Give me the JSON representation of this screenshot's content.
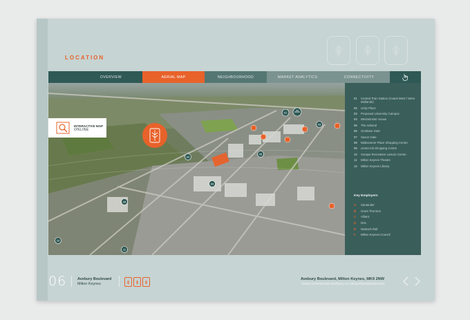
{
  "section_title": "LOCATION",
  "nav": {
    "tabs": [
      {
        "label": "OVERVIEW"
      },
      {
        "label": "AERIAL MAP"
      },
      {
        "label": "NEIGHBOURHOOD"
      },
      {
        "label": "MARKET ANALYTICS"
      },
      {
        "label": "CONNECTIVITY"
      }
    ],
    "active_tab": "AERIAL MAP"
  },
  "map": {
    "interactive_label_line1": "INTERACTIVE MAP",
    "interactive_label_line2": "ONLINE"
  },
  "legend": {
    "places": [
      {
        "num": "01",
        "label": "Central Train Station (Avanti West / West Midlands)"
      },
      {
        "num": "02",
        "label": "Unity Place"
      },
      {
        "num": "03",
        "label": "Proposed University Campus"
      },
      {
        "num": "04",
        "label": "Westminster House"
      },
      {
        "num": "05",
        "label": "The Admiral"
      },
      {
        "num": "06",
        "label": "Gentlane Gate"
      },
      {
        "num": "07",
        "label": "Saxon Gate"
      },
      {
        "num": "08",
        "label": "Midsummer Place Shopping Centre"
      },
      {
        "num": "09",
        "label": "centre:mk Shopping Centre"
      },
      {
        "num": "10",
        "label": "Xscape Recreation Leisure Centre"
      },
      {
        "num": "11",
        "label": "Milton Keynes Theatre"
      },
      {
        "num": "12",
        "label": "Milton Keynes Library"
      }
    ],
    "key_employers_title": "Key Employers",
    "employers": [
      {
        "letter": "A",
        "label": "Santander"
      },
      {
        "letter": "B",
        "label": "Grant Thornton"
      },
      {
        "letter": "C",
        "label": "Allianz"
      },
      {
        "letter": "D",
        "label": "DHL"
      },
      {
        "letter": "E",
        "label": "Network Rail"
      },
      {
        "letter": "F",
        "label": "Milton Keynes Council"
      }
    ]
  },
  "footer": {
    "page_number": "06",
    "address_line1": "Avebury Boulevard",
    "address_line2": "Milton Keynes",
    "full_address": "Avebury Boulevard, Milton Keynes, MK9 2NW",
    "website": "www.commercial-avebury.co.uk/aveburyboulevard"
  },
  "colors": {
    "accent": "#e8622a",
    "panel": "#3a5f5b",
    "page_bg": "#c6d4d3"
  }
}
